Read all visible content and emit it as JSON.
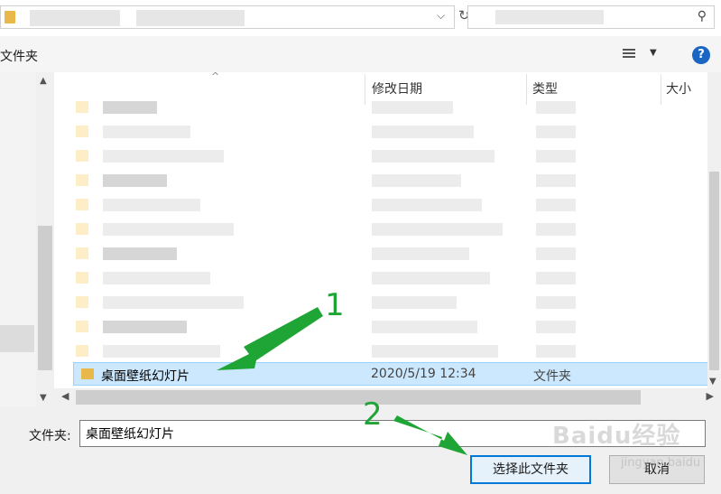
{
  "toolbar": {
    "folder_label_cut": "文件夹",
    "help": "?"
  },
  "columns": {
    "date": "修改日期",
    "type": "类型",
    "size": "大小"
  },
  "selected_item": {
    "name": "桌面壁纸幻灯片",
    "modified": "2020/5/19 12:34",
    "type": "文件夹"
  },
  "footer": {
    "folder_label": "文件夹:",
    "folder_value": "桌面壁纸幻灯片",
    "select_button": "选择此文件夹",
    "cancel_button": "取消"
  },
  "annotations": {
    "step1": "1",
    "step2": "2"
  },
  "watermark": {
    "brand": "Baidu经验",
    "url": "jingyan.baidu"
  },
  "colors": {
    "accent": "#0078d7",
    "selection": "#cce8ff",
    "arrow": "#1fa535",
    "folder": "#e8b84a"
  },
  "icons": [
    "folder-icon",
    "chevron-down-icon",
    "refresh-icon",
    "search-icon",
    "view-details-icon",
    "help-icon"
  ]
}
